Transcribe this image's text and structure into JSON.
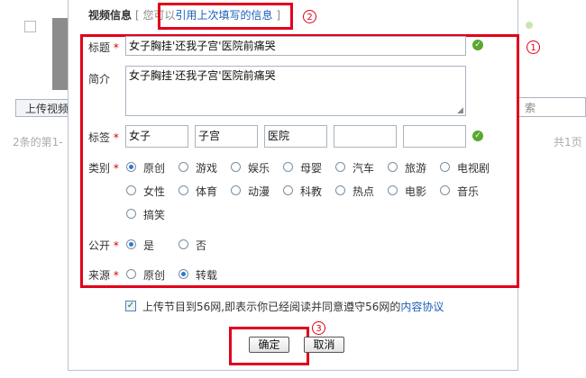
{
  "background": {
    "upload_label": "上传视频",
    "search_label": "索",
    "count_text": "2条的第1-",
    "pages_text": "共1页"
  },
  "dialog": {
    "section_title": "视频信息",
    "reuse_prefix": "[ 您可以",
    "reuse_link": "引用上次填写的信息",
    "reuse_suffix": "]",
    "title_label": "标题",
    "title_value": "女子胸挂'还我子宫'医院前痛哭",
    "intro_label": "简介",
    "intro_value": "女子胸挂'还我子宫'医院前痛哭",
    "tags_label": "标签",
    "tags": [
      "女子",
      "子宫",
      "医院",
      "",
      ""
    ],
    "category_label": "类别",
    "categories": [
      "原创",
      "游戏",
      "娱乐",
      "母婴",
      "汽车",
      "旅游",
      "电视剧",
      "女性",
      "体育",
      "动漫",
      "科教",
      "热点",
      "电影",
      "音乐",
      "搞笑"
    ],
    "category_selected": "原创",
    "public_label": "公开",
    "public_options": [
      "是",
      "否"
    ],
    "public_selected": "是",
    "source_label": "来源",
    "source_options": [
      "原创",
      "转载"
    ],
    "source_selected": "转载",
    "required_mark": "*",
    "agree_prefix": "上传节目到56网,即表示你已经阅读并同意遵守56网的",
    "agree_link": "内容协议",
    "agree_checked": true,
    "confirm_label": "确定",
    "cancel_label": "取消"
  },
  "annotations": {
    "one": "1",
    "two": "2",
    "three": "3"
  },
  "colors": {
    "annotation_red": "#e0001b",
    "link_blue": "#1a5fb4",
    "ok_green": "#5aa82e"
  }
}
